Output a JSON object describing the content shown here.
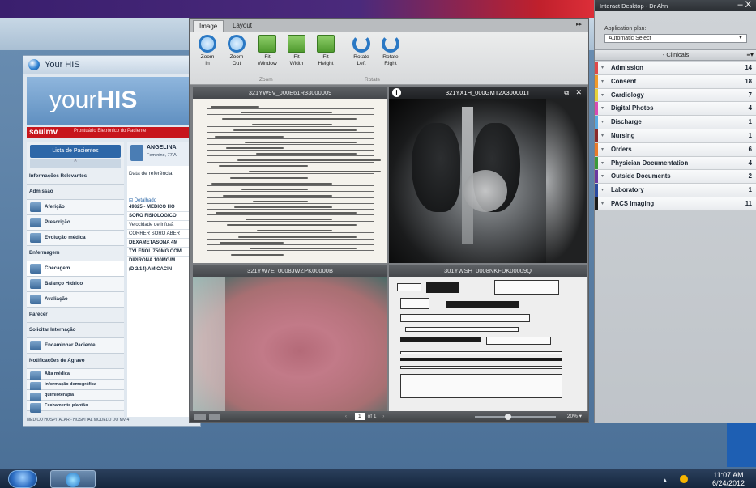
{
  "his": {
    "window_title": "Your HIS",
    "brand_prefix": "your",
    "brand_suffix": "HIS",
    "soul_logo": "soulmv",
    "soul_subtitle": "Prontuário Eletrônico do Paciente",
    "list_button": "Lista de Pacientes",
    "sidebar": [
      {
        "label": "Informações Relevantes",
        "kind": "header"
      },
      {
        "label": "Admissão",
        "kind": "header"
      },
      {
        "label": "Aferição",
        "kind": "icon"
      },
      {
        "label": "Prescrição",
        "kind": "icon"
      },
      {
        "label": "Evolução médica",
        "kind": "icon"
      },
      {
        "label": "Enfermagem",
        "kind": "header"
      },
      {
        "label": "Checagem",
        "kind": "icon",
        "selected": true
      },
      {
        "label": "Balanço Hídrico",
        "kind": "icon"
      },
      {
        "label": "Avaliação",
        "kind": "icon"
      },
      {
        "label": "Parecer",
        "kind": "header"
      },
      {
        "label": "Solicitar Internação",
        "kind": "header"
      },
      {
        "label": "Encaminhar Paciente",
        "kind": "icon"
      },
      {
        "label": "Notificações de Agravo",
        "kind": "header"
      },
      {
        "label": "Alta médica",
        "kind": "small"
      },
      {
        "label": "Informação demográfica",
        "kind": "small"
      },
      {
        "label": "quimioterapia",
        "kind": "small"
      },
      {
        "label": "Fechamento plantão",
        "kind": "small"
      }
    ],
    "patient_name": "ANGELINA",
    "patient_sub": "Feminino, 77 A",
    "ref_date_label": "Data de referência:",
    "detail_label": "⊟ Detalhado",
    "rx_lines": [
      {
        "text": "49825 - MEDICO HO",
        "bold": true
      },
      {
        "text": "SORO FISIOLOGICO",
        "bold": true
      },
      {
        "text": "Velocidade de infusã",
        "bold": false
      },
      {
        "text": "CORRER SORO ABER",
        "bold": false
      },
      {
        "text": "DEXAMETASONA 4M",
        "bold": true
      },
      {
        "text": "TYLENOL 750MG COM",
        "bold": true
      },
      {
        "text": "DIPIRONA 100MG/M",
        "bold": true
      },
      {
        "text": "(D 2/14) AMICACIN",
        "bold": true
      }
    ],
    "status_text": "MEDICO HOSPITALAR - HOSPITAL MODELO DO MV 4"
  },
  "viewer": {
    "tabs": [
      "Image",
      "Layout"
    ],
    "active_tab": "Image",
    "buttons": [
      {
        "id": "zoom-in",
        "label": "Zoom\nIn",
        "icon": "zoom-in-icon"
      },
      {
        "id": "zoom-out",
        "label": "Zoom\nOut",
        "icon": "zoom-out-icon"
      },
      {
        "id": "fit-window",
        "label": "Fit\nWindow",
        "icon": "fit-window-icon"
      },
      {
        "id": "fit-width",
        "label": "Fit\nWidth",
        "icon": "fit-width-icon"
      },
      {
        "id": "fit-height",
        "label": "Fit\nHeight",
        "icon": "fit-height-icon"
      },
      {
        "id": "rotate-left",
        "label": "Rotate\nLeft",
        "icon": "rotate-left-icon"
      },
      {
        "id": "rotate-right",
        "label": "Rotate\nRight",
        "icon": "rotate-right-icon"
      }
    ],
    "group_zoom": "Zoom",
    "group_rotate": "Rotate",
    "panes": [
      {
        "title": "321YW9V_000E61R33000009",
        "type": "document"
      },
      {
        "title": "321YX1H_000GMT2X300001T",
        "type": "xray"
      },
      {
        "title": "321YW7E_0008JWZPK00000B",
        "type": "photo"
      },
      {
        "title": "301YWSH_0008NKFDK00009Q",
        "type": "form"
      }
    ],
    "page_current": "1",
    "page_of": "of 1",
    "zoom_percent": "20%",
    "zoom_level": 0.4
  },
  "interact": {
    "title": "Interact Desktop - Dr Ahn",
    "minimize": "–",
    "close": "X",
    "app_plan_label": "Application plan:",
    "app_plan_value": "Automatic Select",
    "section_title": "- Clinicals",
    "categories": [
      {
        "label": "Admission",
        "count": "14",
        "color": "#e0484a"
      },
      {
        "label": "Consent",
        "count": "18",
        "color": "#f09a2a"
      },
      {
        "label": "Cardiology",
        "count": "7",
        "color": "#e6d23a"
      },
      {
        "label": "Digital Photos",
        "count": "4",
        "color": "#d94bb3"
      },
      {
        "label": "Discharge",
        "count": "1",
        "color": "#5aa8e0"
      },
      {
        "label": "Nursing",
        "count": "1",
        "color": "#8a2a2a"
      },
      {
        "label": "Orders",
        "count": "6",
        "color": "#e87a2a"
      },
      {
        "label": "Physician Documentation",
        "count": "4",
        "color": "#3a9a3a"
      },
      {
        "label": "Outside Documents",
        "count": "2",
        "color": "#6a3aa0"
      },
      {
        "label": "Laboratory",
        "count": "1",
        "color": "#2a4aa0"
      },
      {
        "label": "PACS Imaging",
        "count": "11",
        "color": "#1a1a1a"
      }
    ]
  },
  "taskbar": {
    "time": "11:07 AM",
    "date": "6/24/2012"
  }
}
